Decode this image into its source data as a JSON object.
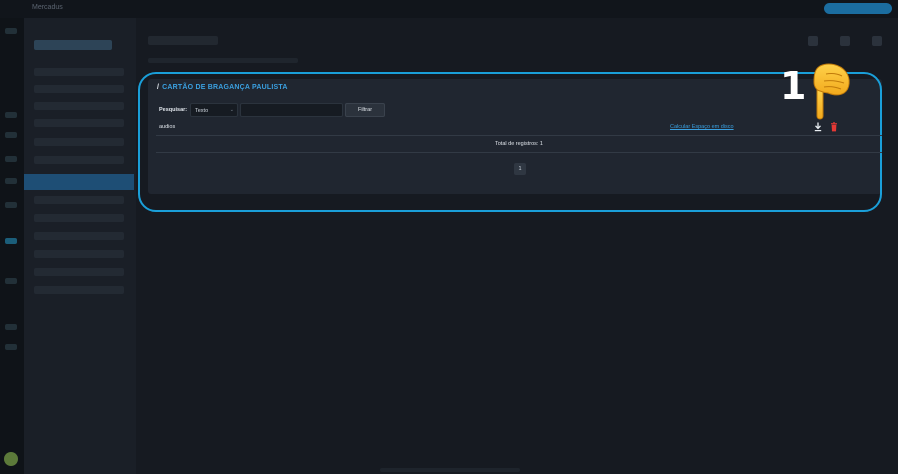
{
  "app": {
    "window_title": "Mercadus"
  },
  "panel": {
    "title": "CARTÃO DE BRAGANÇA PAULISTA",
    "title_prefix": "/"
  },
  "search": {
    "label": "Pesquisar:",
    "select_value": "Texto",
    "input_value": "",
    "filter_label": "Filtrar"
  },
  "table": {
    "rows": [
      {
        "name": "audios",
        "link_label": "Calcular Espaço em disco",
        "actions": [
          "download-icon",
          "trash-icon"
        ]
      }
    ]
  },
  "total": {
    "text": "Total de registros: 1"
  },
  "pagination": {
    "current_page": "1"
  },
  "annotation": {
    "step_number": "1",
    "pointer": "pointing-hand-icon",
    "highlight_color": "#1a9fd9"
  },
  "colors": {
    "accent": "#3aa0e0",
    "danger": "#e53935",
    "background": "#161a21",
    "panel": "#202630"
  }
}
